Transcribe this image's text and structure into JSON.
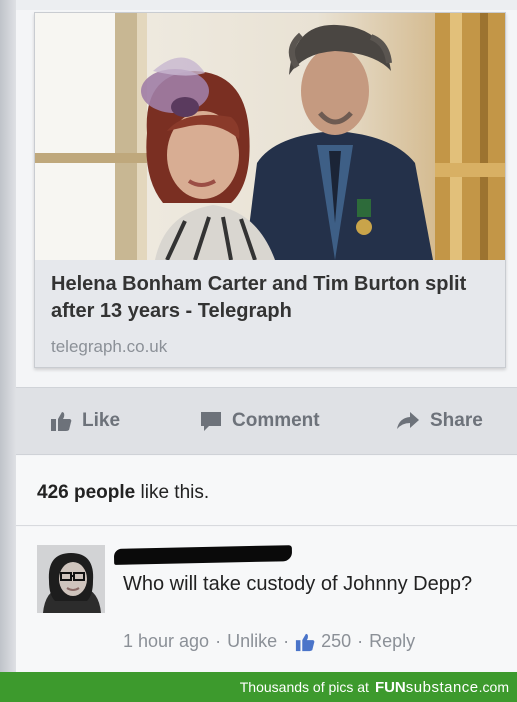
{
  "post": {
    "link_preview": {
      "headline": "Helena Bonham Carter and Tim Burton split after 13 years - Telegraph",
      "domain": "telegraph.co.uk",
      "image": "couple-photo"
    },
    "actions": {
      "like": "Like",
      "comment": "Comment",
      "share": "Share"
    },
    "likes_summary": {
      "count": "426 people",
      "suffix": " like this."
    }
  },
  "comment": {
    "text": "Who will take custody of Johnny Depp?",
    "time": "1 hour ago",
    "unlike": "Unlike",
    "like_count": "250",
    "reply": "Reply",
    "separator": "·"
  },
  "watermark": {
    "left_text": "Thousands of pics at",
    "brand": "FUN",
    "brand_rest": "substance",
    "tld": ".com"
  },
  "colors": {
    "watermark_bar": "#3d9a2d",
    "action_gray": "#6d727a",
    "like_blue": "#4a74c9"
  }
}
